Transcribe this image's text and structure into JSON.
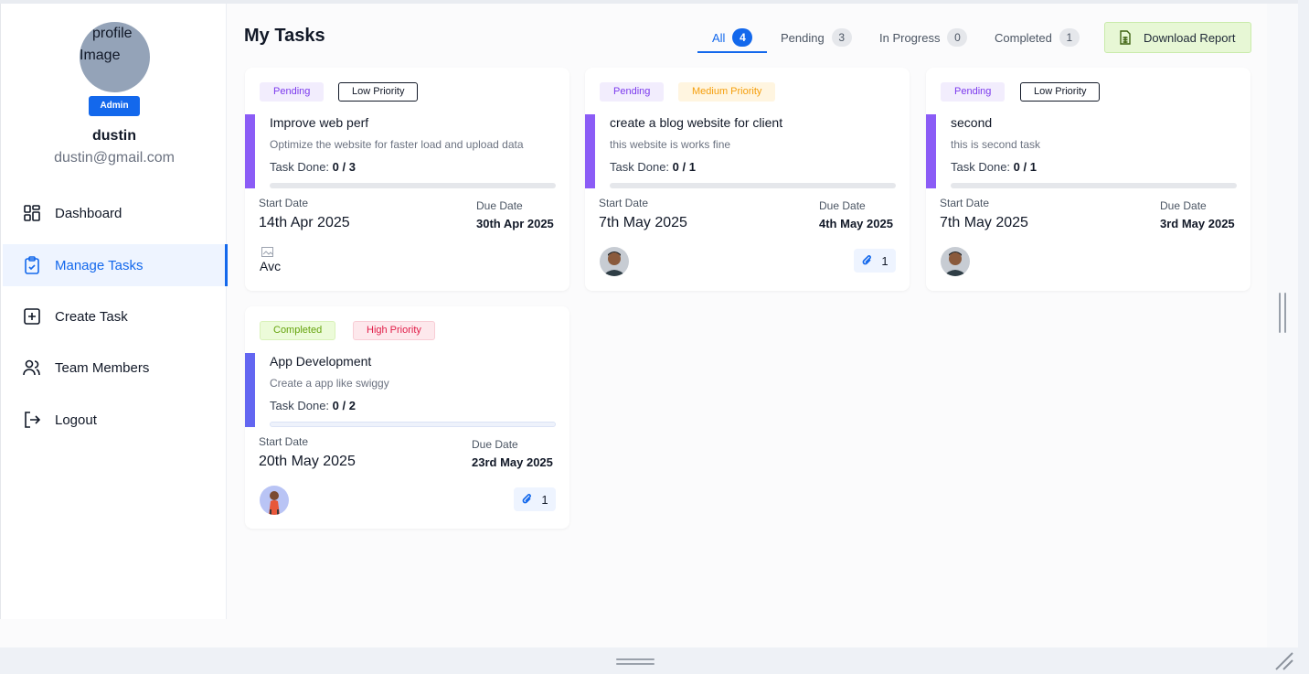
{
  "sidebar": {
    "avatar_alt_line1": "profile",
    "avatar_alt_line2": "Image",
    "role_badge": "Admin",
    "user_name": "dustin",
    "user_email": "dustin@gmail.com",
    "items": [
      {
        "label": "Dashboard",
        "icon": "dashboard-grid-icon",
        "active": false
      },
      {
        "label": "Manage Tasks",
        "icon": "clipboard-check-icon",
        "active": true
      },
      {
        "label": "Create Task",
        "icon": "plus-square-icon",
        "active": false
      },
      {
        "label": "Team Members",
        "icon": "users-icon",
        "active": false
      },
      {
        "label": "Logout",
        "icon": "logout-icon",
        "active": false
      }
    ]
  },
  "header": {
    "title": "My Tasks",
    "tabs": [
      {
        "label": "All",
        "count": "4",
        "active": true
      },
      {
        "label": "Pending",
        "count": "3",
        "active": false
      },
      {
        "label": "In Progress",
        "count": "0",
        "active": false
      },
      {
        "label": "Completed",
        "count": "1",
        "active": false
      }
    ],
    "download_label": "Download Report",
    "download_icon": "spreadsheet-icon"
  },
  "cards": [
    {
      "status": "Pending",
      "priority": "Low Priority",
      "title": "Improve web perf",
      "description": "Optimize the website for faster load and upload data",
      "done_label": "Task Done:",
      "done_value": "0 / 3",
      "progress": 0,
      "start_label": "Start Date",
      "start_date": "14th Apr 2025",
      "due_label": "Due Date",
      "due_date": "30th Apr 2025",
      "assignee_alt": "Avc",
      "attachments": ""
    },
    {
      "status": "Pending",
      "priority": "Medium Priority",
      "title": "create a blog website for client",
      "description": "this website is works fine",
      "done_label": "Task Done:",
      "done_value": "0 / 1",
      "progress": 0,
      "start_label": "Start Date",
      "start_date": "7th May 2025",
      "due_label": "Due Date",
      "due_date": "4th May 2025",
      "attachments": "1"
    },
    {
      "status": "Pending",
      "priority": "Low Priority",
      "title": "second",
      "description": "this is second task",
      "done_label": "Task Done:",
      "done_value": "0 / 1",
      "progress": 0,
      "start_label": "Start Date",
      "start_date": "7th May 2025",
      "due_label": "Due Date",
      "due_date": "3rd May 2025",
      "attachments": ""
    },
    {
      "status": "Completed",
      "priority": "High Priority",
      "title": "App Development",
      "description": "Create a app like swiggy",
      "done_label": "Task Done:",
      "done_value": "0 / 2",
      "progress": 0,
      "start_label": "Start Date",
      "start_date": "20th May 2025",
      "due_label": "Due Date",
      "due_date": "23rd May 2025",
      "attachments": "1"
    }
  ],
  "colors": {
    "accent_blue": "#1368ec",
    "pending_purple": "#8b5cf6",
    "completed_indigo": "#6366f1"
  }
}
